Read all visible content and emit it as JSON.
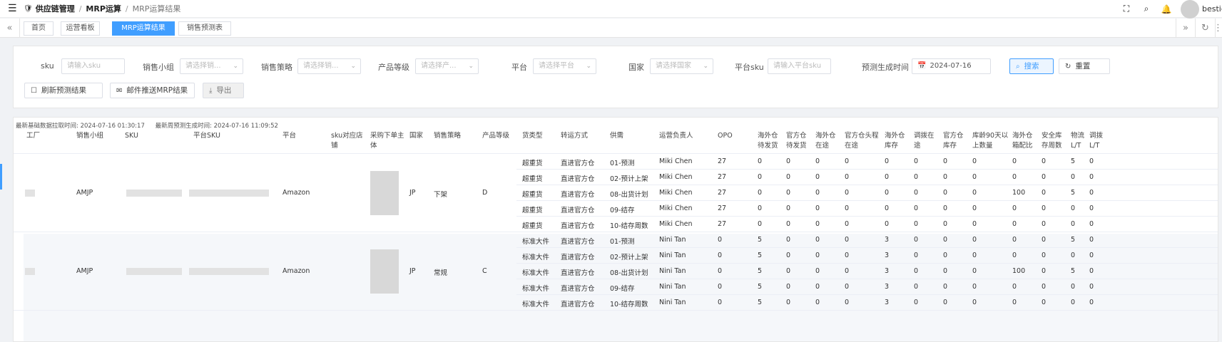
{
  "topbar": {
    "menu_icon": "hamburger-icon",
    "breadcrumb": [
      {
        "label": "供应链管理",
        "icon": "supply-chain-icon"
      },
      {
        "label": "MRP运算"
      },
      {
        "label": "MRP运算结果"
      }
    ],
    "icons": [
      "fullscreen-icon",
      "search-icon",
      "bell-icon"
    ],
    "username": "bestie"
  },
  "tabs": [
    {
      "label": "首页",
      "active": false
    },
    {
      "label": "运营看板",
      "active": false
    },
    {
      "label": "MRP运算结果",
      "active": true
    },
    {
      "label": "销售预测表",
      "active": false
    }
  ],
  "filters": {
    "sku": {
      "label": "sku",
      "placeholder": "请输入sku"
    },
    "sales_group": {
      "label": "销售小组",
      "placeholder": "请选择销..."
    },
    "sales_strategy": {
      "label": "销售策略",
      "placeholder": "请选择销..."
    },
    "product_level": {
      "label": "产品等级",
      "placeholder": "请选择产..."
    },
    "platform": {
      "label": "平台",
      "placeholder": "请选择平台"
    },
    "country": {
      "label": "国家",
      "placeholder": "请选择国家"
    },
    "platform_sku": {
      "label": "平台sku",
      "placeholder": "请输入平台sku"
    },
    "forecast_time": {
      "label": "预测生成时间",
      "value": "2024-07-16"
    }
  },
  "buttons": {
    "search": "搜索",
    "reset": "重置",
    "refresh": "刷新预测结果",
    "email": "邮件推送MRP结果",
    "export": "导出"
  },
  "meta": {
    "base_label": "最新基础数据拉取时间:",
    "base_time": "2024-07-16 01:30:17",
    "forecast_label": "最新周预测生成时间:",
    "forecast_time": "2024-07-16 11:09:52"
  },
  "columns": [
    [
      "工厂"
    ],
    [
      "销售小组"
    ],
    [
      "SKU"
    ],
    [
      "平台SKU"
    ],
    [
      "平台"
    ],
    [
      "sku对应店",
      "铺"
    ],
    [
      "采购下单主",
      "体"
    ],
    [
      "国家"
    ],
    [
      "销售策略"
    ],
    [
      "产品等级"
    ],
    [
      "货类型"
    ],
    [
      "转运方式"
    ],
    [
      "供需"
    ],
    [
      "运营负责人"
    ],
    [
      "OPO"
    ],
    [
      "海外仓",
      "待发货"
    ],
    [
      "官方仓",
      "待发货"
    ],
    [
      "海外仓",
      "在途"
    ],
    [
      "官方仓头程",
      "在途"
    ],
    [
      "海外仓",
      "库存"
    ],
    [
      "调拨在",
      "途"
    ],
    [
      "官方仓",
      "库存"
    ],
    [
      "库龄90天以",
      "上数量"
    ],
    [
      "海外仓",
      "箱配比"
    ],
    [
      "安全库",
      "存周数"
    ],
    [
      "物流",
      "L/T"
    ],
    [
      "调拨",
      "L/T"
    ]
  ],
  "groups": [
    {
      "sales_group": "AMJP",
      "platform": "Amazon",
      "country": "JP",
      "sales_strategy": "下架",
      "product_level": "D",
      "rows": [
        [
          "超重货",
          "直进官方仓",
          "01-预测",
          "Miki Chen",
          "27",
          "0",
          "0",
          "0",
          "0",
          "0",
          "0",
          "0",
          "0",
          "0",
          "0",
          "5",
          "0"
        ],
        [
          "超重货",
          "直进官方仓",
          "02-预计上架",
          "Miki Chen",
          "27",
          "0",
          "0",
          "0",
          "0",
          "0",
          "0",
          "0",
          "0",
          "0",
          "0",
          "0",
          "0"
        ],
        [
          "超重货",
          "直进官方仓",
          "08-出货计划",
          "Miki Chen",
          "27",
          "0",
          "0",
          "0",
          "0",
          "0",
          "0",
          "0",
          "0",
          "100",
          "0",
          "5",
          "0"
        ],
        [
          "超重货",
          "直进官方仓",
          "09-结存",
          "Miki Chen",
          "27",
          "0",
          "0",
          "0",
          "0",
          "0",
          "0",
          "0",
          "0",
          "0",
          "0",
          "0",
          "0"
        ],
        [
          "超重货",
          "直进官方仓",
          "10-结存周数",
          "Miki Chen",
          "27",
          "0",
          "0",
          "0",
          "0",
          "0",
          "0",
          "0",
          "0",
          "0",
          "0",
          "0",
          "0"
        ]
      ]
    },
    {
      "sales_group": "AMJP",
      "platform": "Amazon",
      "country": "JP",
      "sales_strategy": "常规",
      "product_level": "C",
      "rows": [
        [
          "标准大件",
          "直进官方仓",
          "01-预测",
          "Nini Tan",
          "0",
          "5",
          "0",
          "0",
          "0",
          "3",
          "0",
          "0",
          "0",
          "0",
          "0",
          "5",
          "0"
        ],
        [
          "标准大件",
          "直进官方仓",
          "02-预计上架",
          "Nini Tan",
          "0",
          "5",
          "0",
          "0",
          "0",
          "3",
          "0",
          "0",
          "0",
          "0",
          "0",
          "0",
          "0"
        ],
        [
          "标准大件",
          "直进官方仓",
          "08-出货计划",
          "Nini Tan",
          "0",
          "5",
          "0",
          "0",
          "0",
          "3",
          "0",
          "0",
          "0",
          "100",
          "0",
          "5",
          "0"
        ],
        [
          "标准大件",
          "直进官方仓",
          "09-结存",
          "Nini Tan",
          "0",
          "5",
          "0",
          "0",
          "0",
          "3",
          "0",
          "0",
          "0",
          "0",
          "0",
          "0",
          "0"
        ],
        [
          "标准大件",
          "直进官方仓",
          "10-结存周数",
          "Nini Tan",
          "0",
          "5",
          "0",
          "0",
          "0",
          "3",
          "0",
          "0",
          "0",
          "0",
          "0",
          "0",
          "0"
        ]
      ]
    }
  ]
}
